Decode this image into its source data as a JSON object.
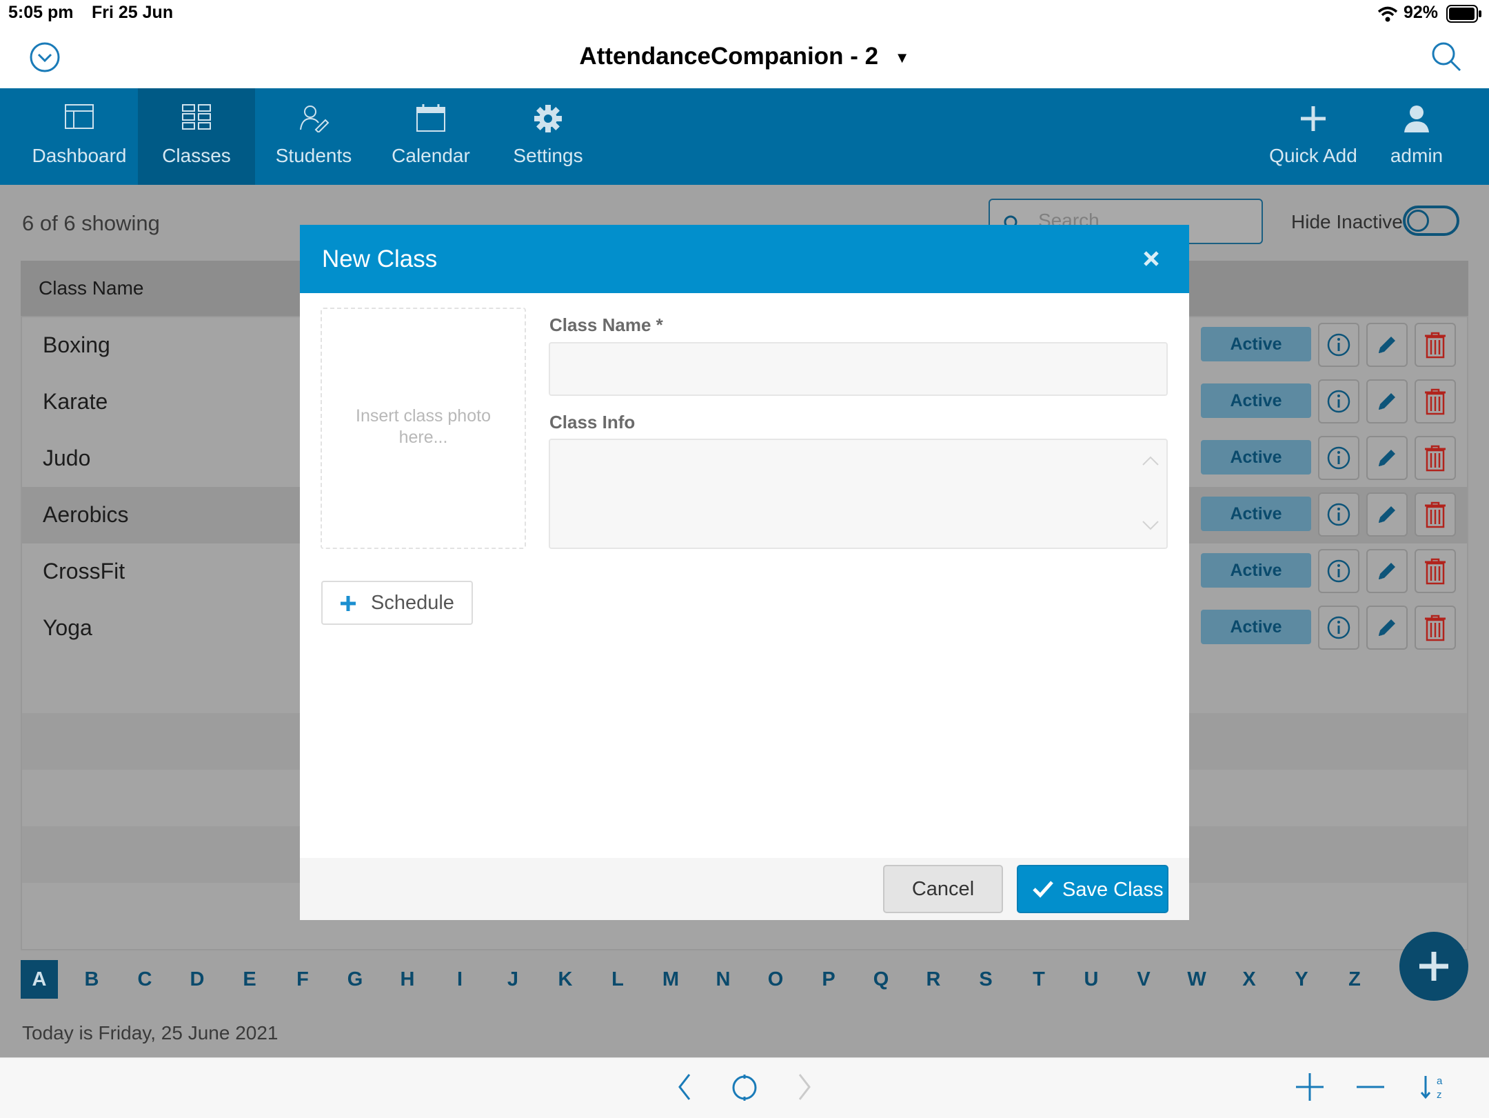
{
  "status_bar": {
    "time": "5:05 pm",
    "date": "Fri 25 Jun",
    "battery": "92%"
  },
  "header": {
    "title": "AttendanceCompanion - 2"
  },
  "nav": {
    "items": [
      {
        "label": "Dashboard",
        "icon": "dashboard-icon"
      },
      {
        "label": "Classes",
        "icon": "grid-icon",
        "active": true
      },
      {
        "label": "Students",
        "icon": "student-icon"
      },
      {
        "label": "Calendar",
        "icon": "calendar-icon"
      },
      {
        "label": "Settings",
        "icon": "gear-icon"
      }
    ],
    "right_items": [
      {
        "label": "Quick Add",
        "icon": "plus-icon"
      },
      {
        "label": "admin",
        "icon": "user-icon"
      }
    ]
  },
  "list": {
    "count_text": "6 of 6 showing",
    "search_placeholder": "Search",
    "hide_inactive_label": "Hide Inactive",
    "hide_inactive_on": false,
    "column_header": "Class Name",
    "rows": [
      {
        "name": "Boxing",
        "status": "Active"
      },
      {
        "name": "Karate",
        "status": "Active"
      },
      {
        "name": "Judo",
        "status": "Active"
      },
      {
        "name": "Aerobics",
        "status": "Active"
      },
      {
        "name": "CrossFit",
        "status": "Active"
      },
      {
        "name": "Yoga",
        "status": "Active"
      }
    ]
  },
  "alphabet": {
    "letters": [
      "A",
      "B",
      "C",
      "D",
      "E",
      "F",
      "G",
      "H",
      "I",
      "J",
      "K",
      "L",
      "M",
      "N",
      "O",
      "P",
      "Q",
      "R",
      "S",
      "T",
      "U",
      "V",
      "W",
      "X",
      "Y",
      "Z"
    ],
    "selected": "A"
  },
  "footer": {
    "date_text": "Today is Friday, 25 June 2021"
  },
  "modal": {
    "title": "New Class",
    "photo_hint": "Insert class photo here...",
    "class_name_label": "Class Name *",
    "class_name_value": "",
    "class_info_label": "Class Info",
    "class_info_value": "",
    "schedule_label": "Schedule",
    "cancel_label": "Cancel",
    "save_label": "Save Class"
  },
  "colors": {
    "nav_bg": "#006ca0",
    "modal_header": "#028fcc",
    "accent_dark": "#0a4a6c",
    "delete_red": "#b2231c"
  }
}
